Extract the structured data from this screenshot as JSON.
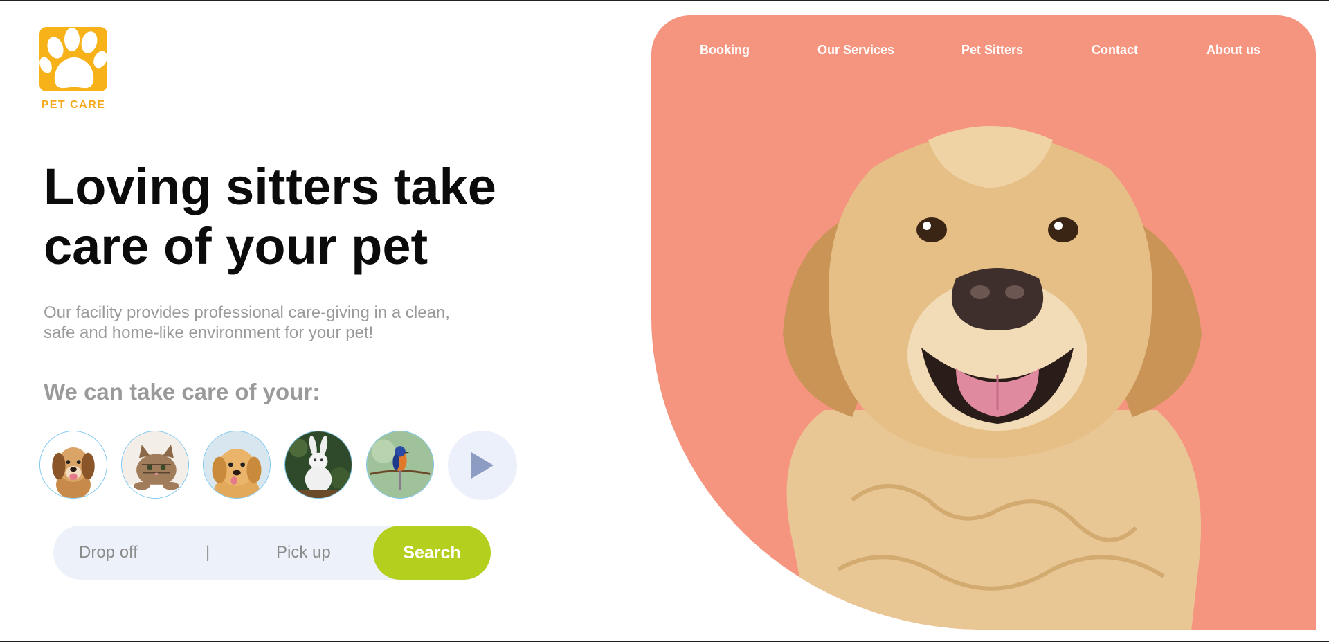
{
  "brand": {
    "name": "PET CARE",
    "logo_icon": "paw-icon",
    "color": "#f7b21a"
  },
  "nav": {
    "items": [
      {
        "label": "Booking"
      },
      {
        "label": "Our Services"
      },
      {
        "label": "Pet Sitters"
      },
      {
        "label": "Contact"
      },
      {
        "label": "About us"
      }
    ]
  },
  "hero": {
    "headline_line1": "Loving sitters take",
    "headline_line2": "care of your pet",
    "subtext_line1": "Our facility provides professional care-giving in a clean,",
    "subtext_line2": "safe and home-like environment for your pet!",
    "care_heading": "We can take care of your:"
  },
  "pets": [
    {
      "name": "puppy"
    },
    {
      "name": "kitten"
    },
    {
      "name": "golden-puppy"
    },
    {
      "name": "rabbit"
    },
    {
      "name": "bird"
    }
  ],
  "search": {
    "drop_off": "Drop off",
    "separator": "|",
    "pick_up": "Pick up",
    "button": "Search"
  },
  "colors": {
    "accent_panel": "#f5957f",
    "search_button": "#b5cf1f",
    "search_bar_bg": "#edf1fa",
    "pet_ring": "#79c6ee"
  }
}
